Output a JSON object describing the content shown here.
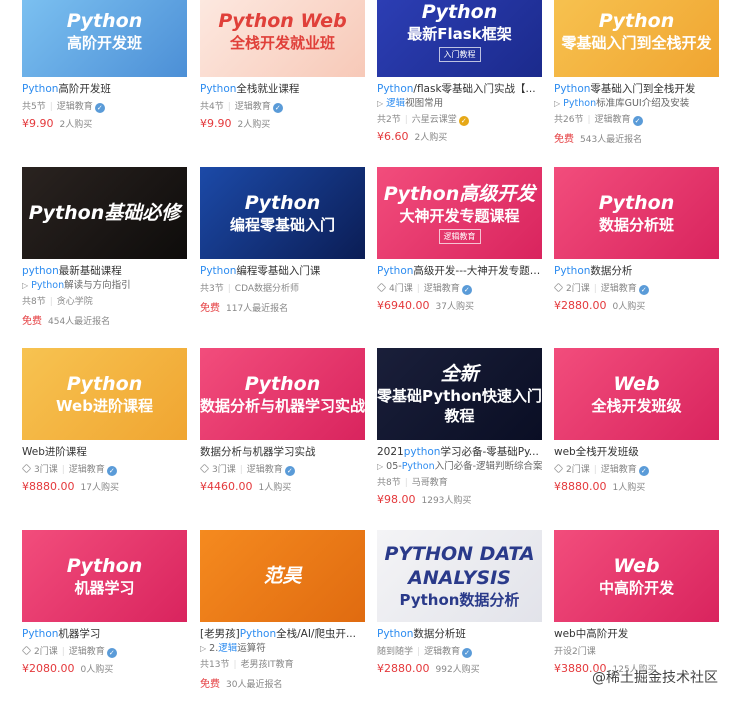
{
  "courses": [
    {
      "thumb": {
        "l1": "Python",
        "l2": "高阶开发班",
        "tag": "",
        "colors": [
          "#7ec3f2",
          "#4c8fd6"
        ],
        "text": "#fff"
      },
      "title_hl": "Python",
      "title_rest": "高阶开发班",
      "sub_hl": "",
      "sub_rest": "",
      "meta": [
        "共5节",
        "逻辑教育"
      ],
      "price": "¥9.90",
      "buys": "2人购买",
      "icon": "",
      "badge": "blue"
    },
    {
      "thumb": {
        "l1": "Python Web",
        "l2": "全栈开发就业班",
        "tag": "",
        "colors": [
          "#fdeae2",
          "#f7c9b8"
        ],
        "text": "#e0403a"
      },
      "title_hl": "Python",
      "title_rest": "全栈就业课程",
      "sub_hl": "",
      "sub_rest": "",
      "meta": [
        "共4节",
        "逻辑教育"
      ],
      "price": "¥9.90",
      "buys": "2人购买",
      "icon": "",
      "badge": "blue"
    },
    {
      "thumb": {
        "l1": "Python",
        "l2": "最新Flask框架",
        "tag": "入门教程",
        "colors": [
          "#2d3fb6",
          "#1b2a8c"
        ],
        "text": "#fff"
      },
      "title_hl": "Python",
      "title_rest": "/flask零基础入门实战【...",
      "sub_hl": "逻辑",
      "sub_rest": "视图常用",
      "meta": [
        "共2节",
        "六星云课堂"
      ],
      "price": "¥6.60",
      "buys": "2人购买",
      "icon": "",
      "badge": "gold"
    },
    {
      "thumb": {
        "l1": "Python",
        "l2": "零基础入门到全栈开发",
        "tag": "",
        "colors": [
          "#f7c351",
          "#f0a531"
        ],
        "text": "#fff"
      },
      "title_hl": "Python",
      "title_rest": "零基础入门到全栈开发",
      "sub_hl": "Python",
      "sub_rest": "标准库GUI介绍及安装",
      "meta": [
        "共26节",
        "逻辑教育"
      ],
      "price": "免费",
      "buys": "543人最近报名",
      "icon": "",
      "badge": "blue"
    },
    {
      "thumb": {
        "l1": "Python基础必修",
        "l2": "",
        "tag": "",
        "colors": [
          "#2a2320",
          "#0e0c0b"
        ],
        "text": "#fff"
      },
      "title_hl": "python",
      "title_rest": "最新基础课程",
      "sub_hl": "Python",
      "sub_rest": "解读与方向指引",
      "meta": [
        "共8节",
        "贪心学院"
      ],
      "price": "免费",
      "buys": "454人最近报名",
      "icon": "",
      "badge": ""
    },
    {
      "thumb": {
        "l1": "Python",
        "l2": "编程零基础入门",
        "tag": "",
        "colors": [
          "#1c4aa8",
          "#0b1d55"
        ],
        "text": "#fff"
      },
      "title_hl": "Python",
      "title_rest": "编程零基础入门课",
      "sub_hl": "",
      "sub_rest": "",
      "meta": [
        "共3节",
        "CDA数据分析师"
      ],
      "price": "免费",
      "buys": "117人最近报名",
      "icon": "",
      "badge": ""
    },
    {
      "thumb": {
        "l1": "Python高级开发",
        "l2": "大神开发专题课程",
        "tag": "逻辑教育",
        "colors": [
          "#f24d7c",
          "#d9245e"
        ],
        "text": "#fff"
      },
      "title_hl": "Python",
      "title_rest": "高级开发---大神开发专题课程",
      "sub_hl": "",
      "sub_rest": "",
      "meta": [
        "4门课",
        "逻辑教育"
      ],
      "price": "¥6940.00",
      "buys": "37人购买",
      "icon": "layers",
      "badge": "blue"
    },
    {
      "thumb": {
        "l1": "Python",
        "l2": "数据分析班",
        "tag": "",
        "colors": [
          "#f24d7c",
          "#d9245e"
        ],
        "text": "#fff"
      },
      "title_hl": "Python",
      "title_rest": "数据分析",
      "sub_hl": "",
      "sub_rest": "",
      "meta": [
        "2门课",
        "逻辑教育"
      ],
      "price": "¥2880.00",
      "buys": "0人购买",
      "icon": "layers",
      "badge": "blue"
    },
    {
      "thumb": {
        "l1": "Python",
        "l2": "Web进阶课程",
        "tag": "",
        "colors": [
          "#f7c351",
          "#f0a531"
        ],
        "text": "#fff"
      },
      "title_hl": "",
      "title_rest": "Web进阶课程",
      "sub_hl": "",
      "sub_rest": "",
      "meta": [
        "3门课",
        "逻辑教育"
      ],
      "price": "¥8880.00",
      "buys": "17人购买",
      "icon": "layers",
      "badge": "blue"
    },
    {
      "thumb": {
        "l1": "Python",
        "l2": "数据分析与机器学习实战",
        "tag": "",
        "colors": [
          "#f24d7c",
          "#d9245e"
        ],
        "text": "#fff"
      },
      "title_hl": "",
      "title_rest": "数据分析与机器学习实战",
      "sub_hl": "",
      "sub_rest": "",
      "meta": [
        "3门课",
        "逻辑教育"
      ],
      "price": "¥4460.00",
      "buys": "1人购买",
      "icon": "layers",
      "badge": "blue"
    },
    {
      "thumb": {
        "l1": "全新",
        "l2": "零基础Python快速入门教程",
        "tag": "",
        "colors": [
          "#1a1f3a",
          "#0a0e24"
        ],
        "text": "#fff"
      },
      "title_hl": "python",
      "title_rest": "学习必备-零基础Py...",
      "title_pre": "2021",
      "sub_hl": "Python",
      "sub_rest": "入门必备-逻辑判断综合案",
      "sub_pre": "05-",
      "meta": [
        "共8节",
        "马哥教育"
      ],
      "price": "¥98.00",
      "buys": "1293人购买",
      "icon": "",
      "badge": ""
    },
    {
      "thumb": {
        "l1": "Web",
        "l2": "全栈开发班级",
        "tag": "",
        "colors": [
          "#f24d7c",
          "#d9245e"
        ],
        "text": "#fff"
      },
      "title_hl": "",
      "title_rest": "web全栈开发班级",
      "sub_hl": "",
      "sub_rest": "",
      "meta": [
        "2门课",
        "逻辑教育"
      ],
      "price": "¥8880.00",
      "buys": "1人购买",
      "icon": "layers",
      "badge": "blue"
    },
    {
      "thumb": {
        "l1": "Python",
        "l2": "机器学习",
        "tag": "",
        "colors": [
          "#f24d7c",
          "#d9245e"
        ],
        "text": "#fff"
      },
      "title_hl": "Python",
      "title_rest": "机器学习",
      "sub_hl": "",
      "sub_rest": "",
      "meta": [
        "2门课",
        "逻辑教育"
      ],
      "price": "¥2080.00",
      "buys": "0人购买",
      "icon": "layers",
      "badge": "blue"
    },
    {
      "thumb": {
        "l1": "范昊",
        "l2": "",
        "tag": "",
        "colors": [
          "#f58a1f",
          "#e06b10"
        ],
        "text": "#fff"
      },
      "title_hl": "Python",
      "title_rest": "全栈/AI/爬虫开...",
      "title_pre": "[老男孩]",
      "sub_hl": "逻辑",
      "sub_rest": "运算符",
      "sub_pre": "2.",
      "meta": [
        "共13节",
        "老男孩IT教育"
      ],
      "price": "免费",
      "buys": "30人最近报名",
      "icon": "",
      "badge": ""
    },
    {
      "thumb": {
        "l1": "PYTHON DATA ANALYSIS",
        "l2": "Python数据分析",
        "tag": "",
        "colors": [
          "#f4f4f6",
          "#e2e3ea"
        ],
        "text": "#2a3a8a"
      },
      "title_hl": "Python",
      "title_rest": "数据分析班",
      "sub_hl": "",
      "sub_rest": "",
      "meta": [
        "随到随学",
        "逻辑教育"
      ],
      "price": "¥2880.00",
      "buys": "992人购买",
      "icon": "",
      "badge": "blue"
    },
    {
      "thumb": {
        "l1": "Web",
        "l2": "中高阶开发",
        "tag": "",
        "colors": [
          "#f24d7c",
          "#d9245e"
        ],
        "text": "#fff"
      },
      "title_hl": "",
      "title_rest": "web中高阶开发",
      "sub_hl": "",
      "sub_rest": "",
      "meta": [
        "开设2门课",
        ""
      ],
      "price": "¥3880.00",
      "buys": "125人购买",
      "icon": "",
      "badge": ""
    }
  ],
  "watermark": "@稀土掘金技术社区"
}
